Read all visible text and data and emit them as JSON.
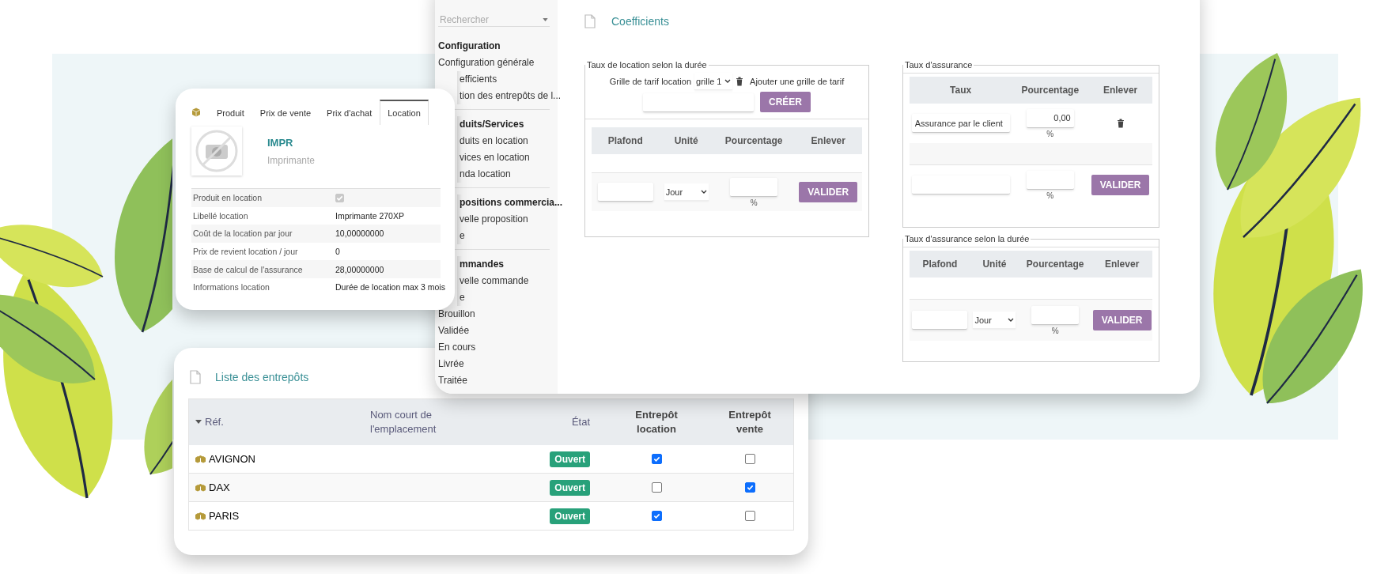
{
  "product_card": {
    "tabs": [
      {
        "label": "Produit",
        "selected": false
      },
      {
        "label": "Prix de vente",
        "selected": false
      },
      {
        "label": "Prix d'achat",
        "selected": false
      },
      {
        "label": "Location",
        "selected": true
      }
    ],
    "code": "IMPR",
    "name": "Imprimante",
    "fields": [
      {
        "kind": "checkbox",
        "label": "Produit en location",
        "checked": true
      },
      {
        "kind": "text",
        "label": "Libellé location",
        "value": "Imprimante 270XP"
      },
      {
        "kind": "text",
        "label": "Coût de la location par jour",
        "value": "10,00000000"
      },
      {
        "kind": "text",
        "label": "Prix de revient location / jour",
        "value": "0"
      },
      {
        "kind": "text",
        "label": "Base de calcul de l'assurance",
        "value": "28,00000000"
      },
      {
        "kind": "text",
        "label": "Informations location",
        "value": "Durée de location max 3 mois"
      }
    ]
  },
  "coefficients_window": {
    "search": {
      "placeholder": "Rechercher"
    },
    "sidebar": [
      {
        "heading": "Configuration",
        "items": [
          {
            "label": "Configuration générale"
          },
          {
            "label": "efficients",
            "cut": true
          },
          {
            "label": "tion des entrepôts de l...",
            "cut": true
          }
        ]
      },
      {
        "heading": "duits/Services",
        "cut": true,
        "items": [
          {
            "label": "duits en location",
            "cut": true
          },
          {
            "label": "vices en location",
            "cut": true
          },
          {
            "label": "nda location",
            "cut": true
          }
        ]
      },
      {
        "heading": "positions commercia...",
        "cut": true,
        "items": [
          {
            "label": "velle proposition",
            "cut": true
          },
          {
            "label": "e",
            "cut": true
          }
        ]
      },
      {
        "heading": "mmandes",
        "cut": true,
        "items": [
          {
            "label": "velle commande",
            "cut": true
          },
          {
            "label": "e",
            "cut": true
          },
          {
            "label": "Brouillon"
          },
          {
            "label": "Validée"
          },
          {
            "label": "En cours"
          },
          {
            "label": "Livrée"
          },
          {
            "label": "Traitée"
          }
        ]
      }
    ],
    "title": "Coefficients",
    "rental_rate": {
      "legend": "Taux de location selon la durée",
      "grid_label": "Grille de tarif location",
      "grid_value": "grille 1",
      "add_label": "Ajouter une grille de tarif",
      "create_button": "CRÉER",
      "columns": [
        "Plafond",
        "Unité",
        "Pourcentage",
        "Enlever"
      ],
      "new_row": {
        "unit": "Jour",
        "percent_unit": "%",
        "button": "VALIDER"
      }
    },
    "insurance_rate": {
      "legend": "Taux d'assurance",
      "columns": [
        "Taux",
        "Pourcentage",
        "Enlever"
      ],
      "rows": [
        {
          "rate": "Assurance par le client",
          "percent": "0,00",
          "percent_unit": "%"
        }
      ],
      "new_row": {
        "percent_unit": "%",
        "button": "VALIDER"
      }
    },
    "insurance_duration": {
      "legend": "Taux d'assurance selon la durée",
      "columns": [
        "Plafond",
        "Unité",
        "Pourcentage",
        "Enlever"
      ],
      "new_row": {
        "unit": "Jour",
        "percent_unit": "%",
        "button": "VALIDER"
      }
    }
  },
  "warehouses": {
    "title": "Liste des entrepôts",
    "columns": [
      {
        "label": "Réf.",
        "kind": "sorted"
      },
      {
        "label": "Nom court de l'emplacement",
        "kind": "plain"
      },
      {
        "label": "État",
        "kind": "right"
      },
      {
        "label": "Entrepôt location",
        "kind": "bold"
      },
      {
        "label": "Entrepôt vente",
        "kind": "bold"
      }
    ],
    "rows": [
      {
        "ref": "AVIGNON",
        "state": "Ouvert",
        "rental": true,
        "sale": false
      },
      {
        "ref": "DAX",
        "state": "Ouvert",
        "rental": false,
        "sale": true
      },
      {
        "ref": "PARIS",
        "state": "Ouvert",
        "rental": true,
        "sale": false
      }
    ]
  }
}
